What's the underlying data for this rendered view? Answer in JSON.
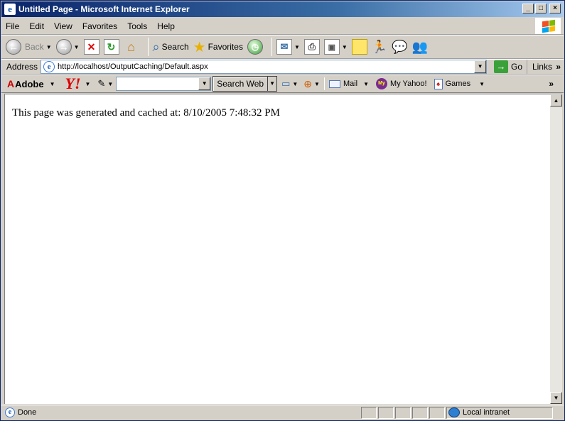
{
  "window": {
    "title": "Untitled Page - Microsoft Internet Explorer",
    "controls": {
      "minimize": "_",
      "maximize": "□",
      "close": "×"
    }
  },
  "menu": [
    "File",
    "Edit",
    "View",
    "Favorites",
    "Tools",
    "Help"
  ],
  "toolbar": {
    "back_label": "Back",
    "search_label": "Search",
    "favorites_label": "Favorites"
  },
  "address": {
    "label": "Address",
    "url": "http://localhost/OutputCaching/Default.aspx",
    "go_label": "Go",
    "links_label": "Links"
  },
  "yahoo_toolbar": {
    "adobe_label": "Adobe",
    "search_value": "",
    "search_web_label": "Search Web",
    "mail_label": "Mail",
    "my_yahoo_label": "My Yahoo!",
    "games_label": "Games"
  },
  "page": {
    "message": "This page was generated and cached at: 8/10/2005 7:48:32 PM"
  },
  "status": {
    "text": "Done",
    "zone": "Local intranet"
  },
  "colors": {
    "titlebar": "#0a246a",
    "chrome": "#d4d0c8"
  }
}
